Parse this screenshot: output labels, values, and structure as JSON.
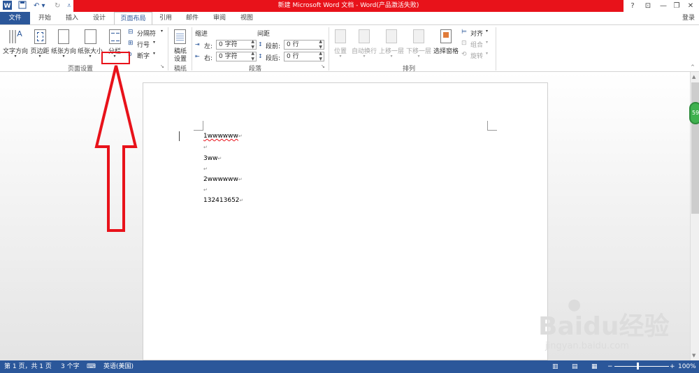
{
  "title_bar": {
    "title": "新建 Microsoft Word 文档 - Word(产品激活失败)",
    "help": "?",
    "ribbon_options": "⊡",
    "minimize": "—",
    "restore": "❐",
    "close": "✕",
    "sign_in": "登录"
  },
  "tabs": [
    "文件",
    "开始",
    "插入",
    "设计",
    "页面布局",
    "引用",
    "邮件",
    "审阅",
    "视图"
  ],
  "ribbon": {
    "page_setup": {
      "text_direction": "文字方向",
      "margins": "页边距",
      "orientation": "纸张方向",
      "size": "纸张大小",
      "columns": "分栏",
      "breaks": "分隔符",
      "line_numbers": "行号",
      "hyphenation": "断字",
      "group_label": "页面设置"
    },
    "manuscript": {
      "settings_line1": "稿纸",
      "settings_line2": "设置",
      "group_label": "稿纸"
    },
    "paragraph": {
      "indent_label": "缩进",
      "spacing_label": "间距",
      "left_label": "左:",
      "left_value": "0 字符",
      "right_label": "右:",
      "right_value": "0 字符",
      "before_label": "段前:",
      "before_value": "0 行",
      "after_label": "段后:",
      "after_value": "0 行",
      "group_label": "段落"
    },
    "arrange": {
      "position": "位置",
      "wrap_text": "自动换行",
      "bring_forward": "上移一层",
      "send_backward": "下移一层",
      "selection_pane": "选择窗格",
      "align": "对齐",
      "group": "组合",
      "rotate": "旋转",
      "group_label": "排列"
    }
  },
  "document": {
    "lines": [
      "1wwwwww",
      "",
      "3ww",
      "",
      "2wwwwww",
      "",
      "132413652"
    ],
    "paragraph_mark": "↵"
  },
  "watermark": {
    "brand": "Baidu经验",
    "url": "jingyan.baidu.com"
  },
  "side_badge": "59",
  "status_bar": {
    "page": "第 1 页，共 1 页",
    "words": "3 个字",
    "language": "英语(美国)",
    "zoom": "100%",
    "zoom_minus": "−",
    "zoom_plus": "+"
  },
  "colors": {
    "title_red": "#e8121a",
    "word_blue": "#2b579a",
    "annotation_red": "#e8121a"
  }
}
